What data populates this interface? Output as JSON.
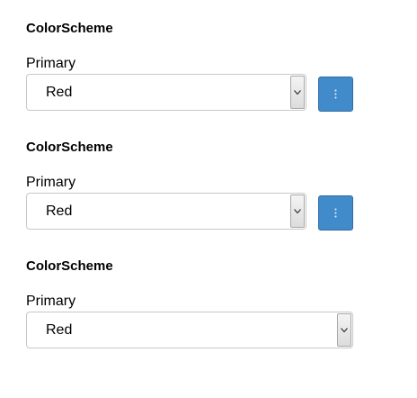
{
  "accent_color": "#428bca",
  "groups": [
    {
      "heading": "ColorScheme",
      "label": "Primary",
      "selected": "Red",
      "has_menu_button": true,
      "menu_icon": "vertical-ellipsis-icon"
    },
    {
      "heading": "ColorScheme",
      "label": "Primary",
      "selected": "Red",
      "has_menu_button": true,
      "menu_icon": "vertical-ellipsis-icon"
    },
    {
      "heading": "ColorScheme",
      "label": "Primary",
      "selected": "Red",
      "has_menu_button": false
    }
  ]
}
